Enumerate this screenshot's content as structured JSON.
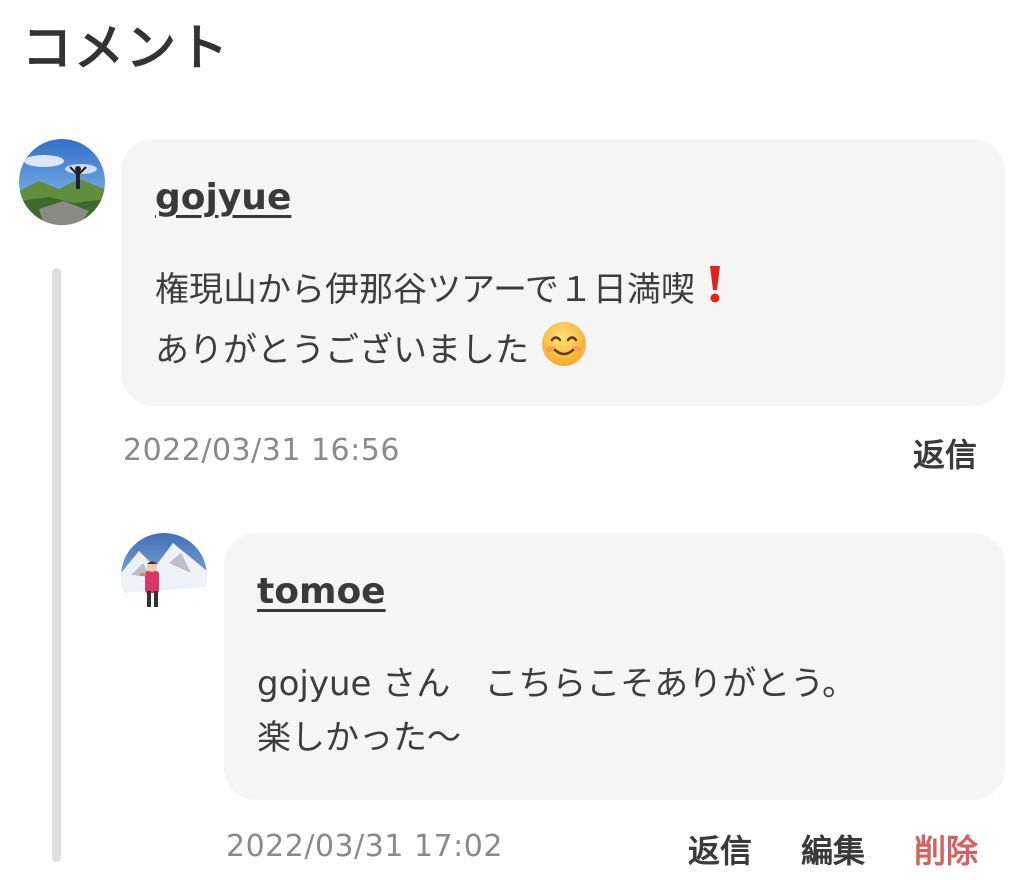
{
  "section": {
    "title": "コメント"
  },
  "comments": [
    {
      "user": "gojyue",
      "lines": [
        "権現山から伊那谷ツアーで１日満喫",
        "ありがとうございました"
      ],
      "emoji": [
        "exclamation-emoji",
        "smile-emoji"
      ],
      "timestamp": "2022/03/31 16:56",
      "actions": [
        "返信"
      ]
    },
    {
      "user": "tomoe",
      "lines": [
        "gojyue さん　こちらこそありがとう。",
        "楽しかった〜"
      ],
      "timestamp": "2022/03/31 17:02",
      "actions": [
        "返信",
        "編集",
        "削除"
      ]
    }
  ],
  "colors": {
    "delete_action": "#d0635f",
    "bubble_bg": "#f5f5f5"
  }
}
